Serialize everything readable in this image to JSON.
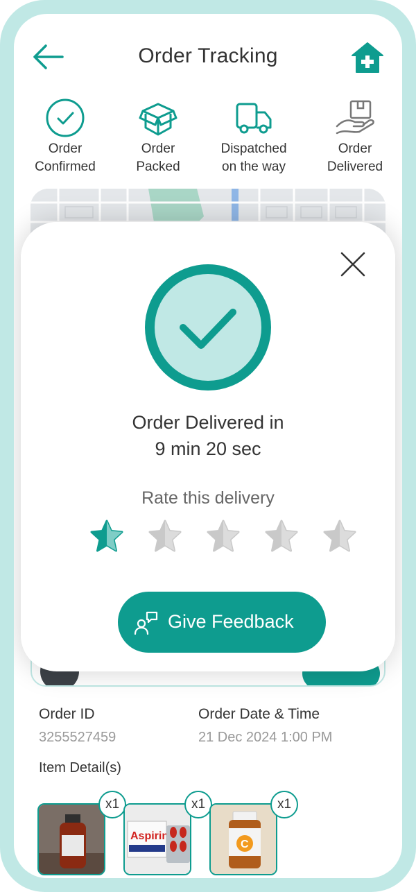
{
  "header": {
    "title": "Order Tracking",
    "back_icon": "arrow-left-icon",
    "home_icon": "home-medical-icon"
  },
  "steps": [
    {
      "line1": "Order",
      "line2": "Confirmed",
      "icon": "check-circle-icon"
    },
    {
      "line1": "Order",
      "line2": "Packed",
      "icon": "box-icon"
    },
    {
      "line1": "Dispatched",
      "line2": "on the way",
      "icon": "truck-icon"
    },
    {
      "line1": "Order",
      "line2": "Delivered",
      "icon": "hand-box-icon"
    }
  ],
  "modal": {
    "delivered_line1": "Order Delivered in",
    "delivered_line2": "9 min 20 sec",
    "rate_label": "Rate this delivery",
    "rating": 1,
    "max_rating": 5,
    "feedback_label": "Give Feedback"
  },
  "order": {
    "id_label": "Order ID",
    "id_value": "3255527459",
    "date_label": "Order Date & Time",
    "date_value": "21 Dec 2024 1:00 PM",
    "items_label": "Item Detail(s)",
    "items": [
      {
        "qty": "x1",
        "name": "Amber bottle"
      },
      {
        "qty": "x1",
        "name": "Aspirin"
      },
      {
        "qty": "x1",
        "name": "Vitamin C"
      }
    ]
  },
  "colors": {
    "accent": "#0e9c8f",
    "accent_light": "#c0e8e5",
    "star_inactive": "#c9c9c9"
  }
}
